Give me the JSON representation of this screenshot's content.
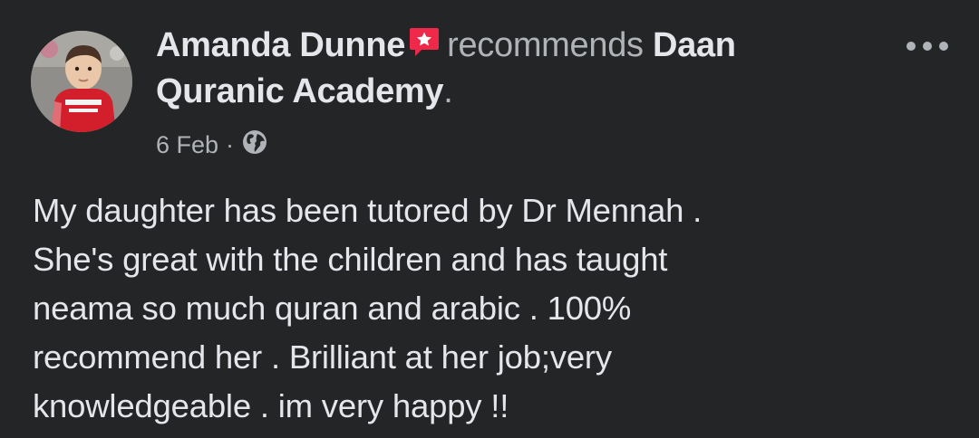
{
  "post": {
    "author": "Amanda Dunne",
    "action": "recommends",
    "page_name_line1": "Daan",
    "page_name_line2": "Quranic Academy",
    "punctuation": ".",
    "date": "6 Feb",
    "separator": "·",
    "audience_icon": "globe-icon",
    "badge_icon": "recommendation-badge-icon",
    "more_icon": "more-options-icon",
    "review_lines": [
      "My daughter has been tutored by Dr Mennah .",
      "She's great with the children and has taught",
      "neama so much quran and arabic . 100%",
      "recommend her . Brilliant at her job;very",
      "knowledgeable . im very happy !!"
    ]
  },
  "colors": {
    "background": "#242526",
    "primary_text": "#e4e6eb",
    "secondary_text": "#b0b3b8",
    "badge": "#f02849"
  }
}
